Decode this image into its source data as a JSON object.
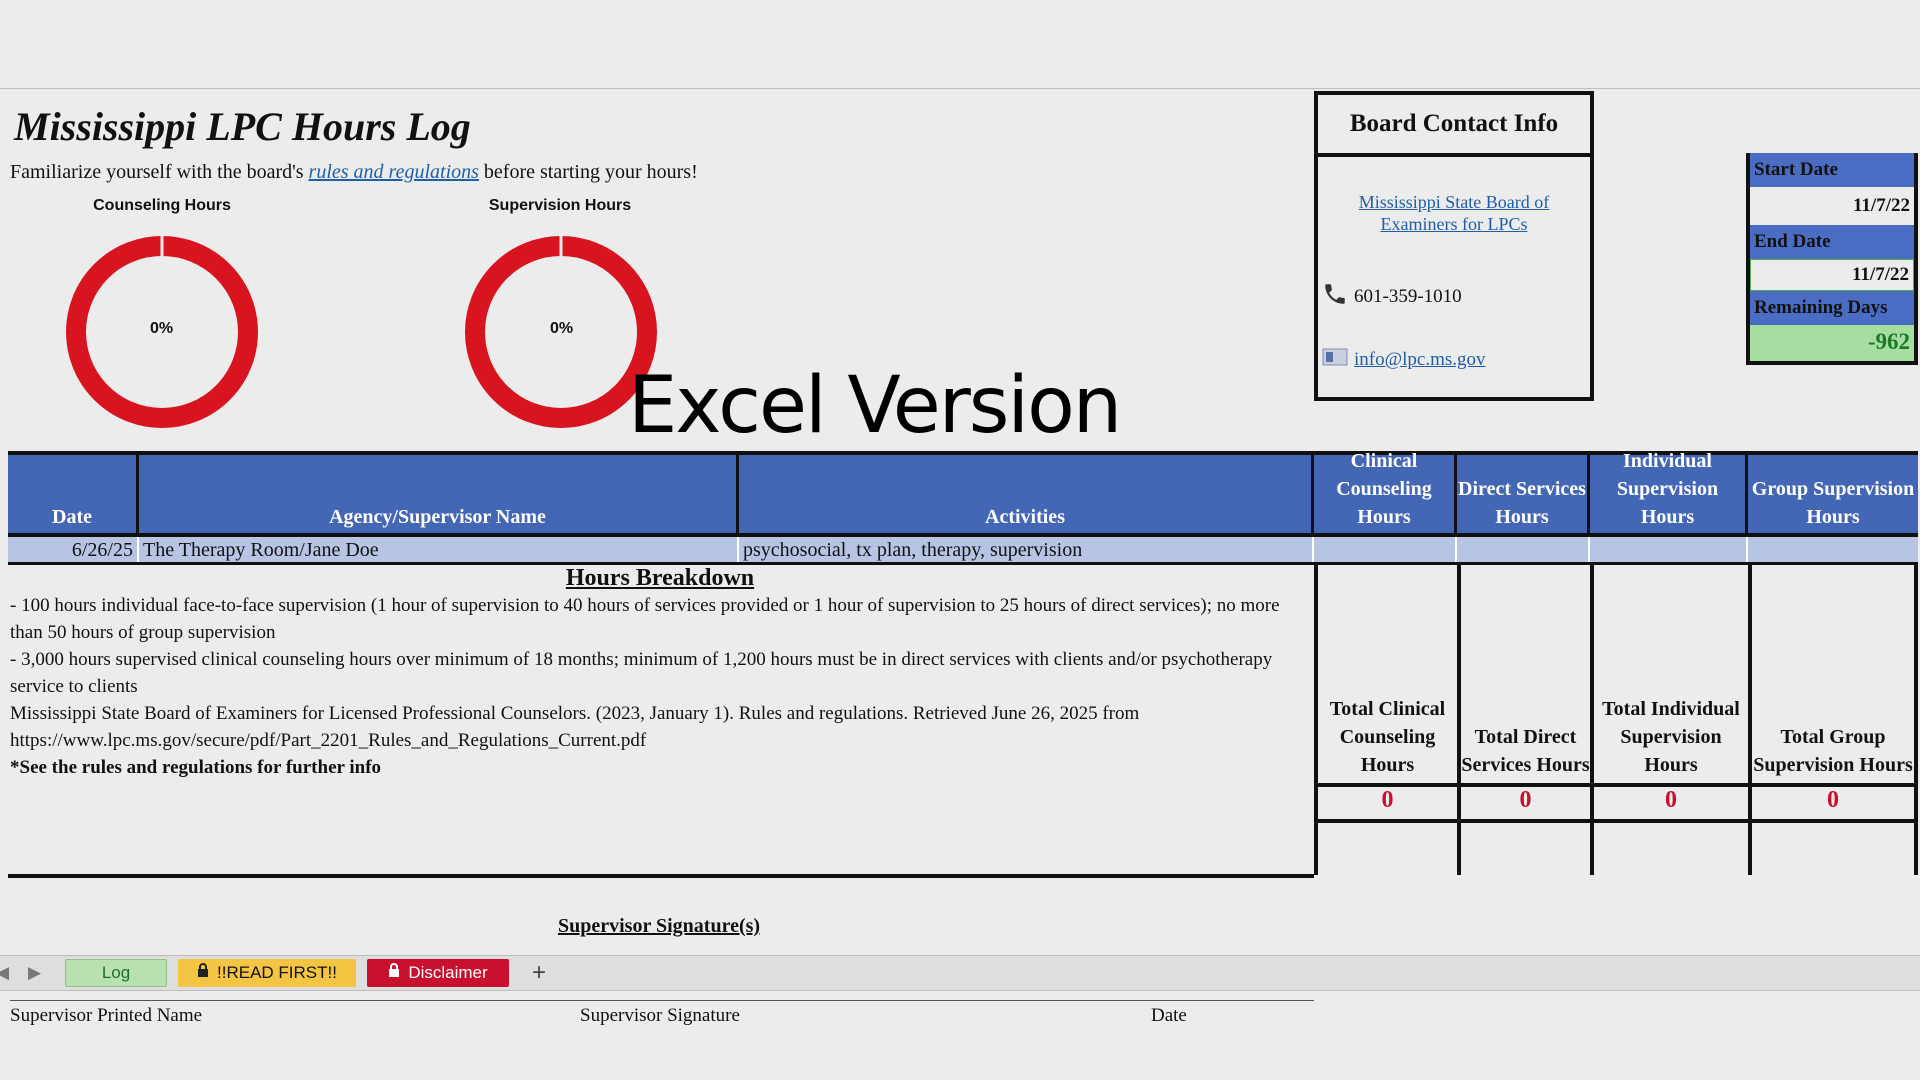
{
  "title": "Mississippi LPC Hours Log",
  "intro": {
    "before": "Familiarize yourself with the board's ",
    "link": "rules and regulations",
    "after": " before starting your hours!"
  },
  "charts": [
    {
      "title": "Counseling Hours",
      "percent_label": "0%",
      "value": 0,
      "color": "#d7141f"
    },
    {
      "title": "Supervision Hours",
      "percent_label": "0%",
      "value": 0,
      "color": "#d7141f"
    }
  ],
  "watermark": "Excel Version",
  "board": {
    "heading": "Board Contact Info",
    "link": "Mississippi State Board of Examiners for LPCs",
    "phone_icon": "phone-icon",
    "phone": "601-359-1010",
    "email_icon": "email-icon",
    "email": "info@lpc.ms.gov"
  },
  "dates": {
    "start_label": "Start Date",
    "start_value": "11/7/22",
    "end_label": "End Date",
    "end_value": "11/7/22",
    "remaining_label": "Remaining Days",
    "remaining_value": "-962"
  },
  "table": {
    "headers": [
      "Date",
      "Agency/Supervisor Name",
      "Activities",
      "Clinical Counseling Hours",
      "Direct Services Hours",
      "Individual Supervision Hours",
      "Group Supervision Hours"
    ],
    "rows": [
      {
        "date": "6/26/25",
        "agency": "The Therapy Room/Jane Doe",
        "activities": "psychosocial, tx plan, therapy, supervision",
        "clinical": "",
        "direct": "",
        "individual": "",
        "group": ""
      }
    ]
  },
  "breakdown": {
    "heading": "Hours Breakdown",
    "lines": [
      "- 100 hours individual face-to-face supervision (1 hour of supervision to 40 hours of services provided or 1 hour of supervision to 25 hours of direct services); no more than 50 hours of group supervision",
      "- 3,000 hours supervised clinical counseling hours over minimum of 18 months; minimum of 1,200 hours must be in direct services with clients and/or psychotherapy service to clients",
      "Mississippi State Board of Examiners for Licensed Professional Counselors. (2023, January 1). Rules and regulations. Retrieved June 26, 2025 from https://www.lpc.ms.gov/secure/pdf/Part_2201_Rules_and_Regulations_Current.pdf"
    ],
    "note": "*See the rules and regulations for further info"
  },
  "totals": [
    {
      "label": "Total Clinical Counseling Hours",
      "value": "0"
    },
    {
      "label": "Total Direct Services Hours",
      "value": "0"
    },
    {
      "label": "Total Individual Supervision Hours",
      "value": "0"
    },
    {
      "label": "Total Group Supervision Hours",
      "value": "0"
    }
  ],
  "signature": {
    "heading": "Supervisor Signature(s)",
    "printed_name": "Supervisor Printed Name",
    "signature": "Supervisor Signature",
    "date": "Date"
  },
  "tabs": [
    {
      "label": "Log",
      "bg": "#b9e0b0",
      "fg": "#1d6e2a",
      "locked": false
    },
    {
      "label": "!!READ FIRST!!",
      "bg": "#f4c542",
      "fg": "#111111",
      "locked": true
    },
    {
      "label": "Disclaimer",
      "bg": "#c8102e",
      "fg": "#ffffff",
      "locked": true
    }
  ],
  "add_sheet": "+"
}
